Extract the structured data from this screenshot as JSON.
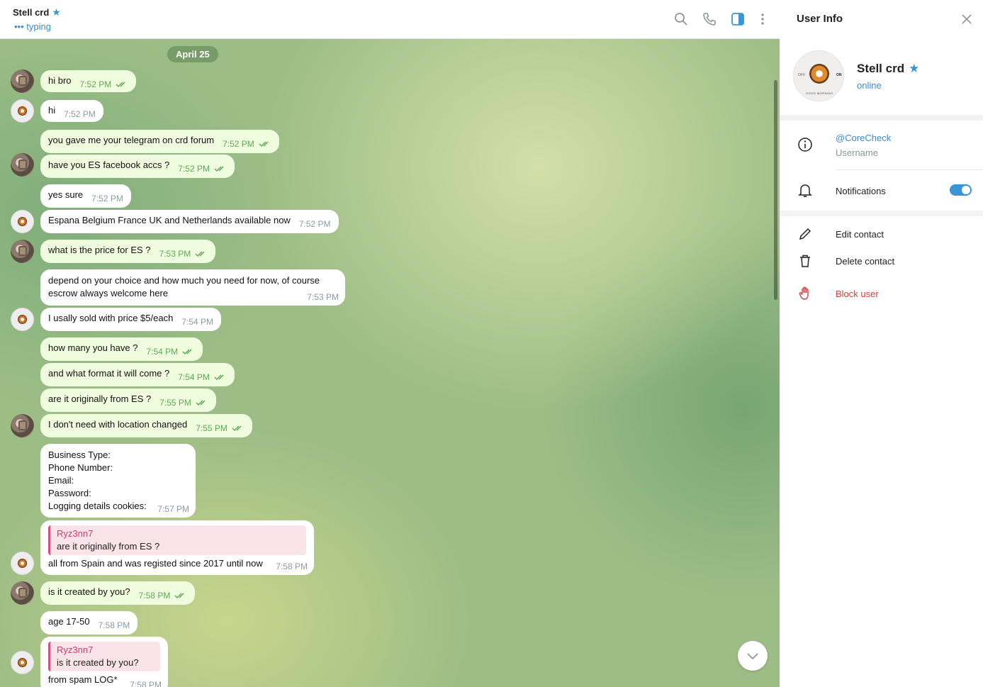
{
  "chat": {
    "name": "Stell crd",
    "status": "typing",
    "date_label": "April 25",
    "messages": [
      {
        "text": "hi bro",
        "time": "7:52 PM",
        "out": true
      },
      {
        "text": "hi",
        "time": "7:52 PM",
        "out": false
      },
      {
        "text": "you gave me your telegram on crd forum",
        "time": "7:52 PM",
        "out": true
      },
      {
        "text": "have you ES facebook accs ?",
        "time": "7:52 PM",
        "out": true
      },
      {
        "text": "yes sure",
        "time": "7:52 PM",
        "out": false
      },
      {
        "text": "Espana Belgium France UK and Netherlands available now",
        "time": "7:52 PM",
        "out": false
      },
      {
        "text": "what is the price for ES ?",
        "time": "7:53 PM",
        "out": true
      },
      {
        "lines": [
          "depend on your choice and how much you need for now, of course",
          "escrow always welcome here"
        ],
        "time": "7:53 PM",
        "out": false
      },
      {
        "text": "I usally sold with price $5/each",
        "time": "7:54 PM",
        "out": false
      },
      {
        "text": "how many you have ?",
        "time": "7:54 PM",
        "out": true
      },
      {
        "text": "and what format it will come ?",
        "time": "7:54 PM",
        "out": true
      },
      {
        "text": "are it originally from ES ?",
        "time": "7:55 PM",
        "out": true
      },
      {
        "text": "I don't need with location changed",
        "time": "7:55 PM",
        "out": true
      },
      {
        "lines": [
          "Business Type:",
          "Phone Number:",
          "Email:",
          "Password:",
          "Logging details cookies:"
        ],
        "time": "7:57 PM",
        "out": false
      },
      {
        "reply_name": "Ryz3nn7",
        "reply_text": "are it originally from ES ?",
        "text": "all from Spain and was registed since 2017 until now",
        "time": "7:58 PM",
        "out": false
      },
      {
        "text": "is it created by you?",
        "time": "7:58 PM",
        "out": true
      },
      {
        "text": "age 17-50",
        "time": "7:58 PM",
        "out": false
      },
      {
        "reply_name": "Ryz3nn7",
        "reply_text": "is it created by you?",
        "text": "from spam LOG*",
        "time": "7:58 PM",
        "out": false
      }
    ]
  },
  "side": {
    "title": "User Info",
    "name": "Stell crd",
    "status": "online",
    "avatar_text": {
      "off": "OFF",
      "on": "ON",
      "caption": "GOOD MORNING"
    },
    "username": "@CoreCheck",
    "username_label": "Username",
    "notifications_label": "Notifications",
    "notifications_on": true,
    "edit_label": "Edit contact",
    "delete_label": "Delete contact",
    "block_label": "Block user"
  },
  "colors": {
    "accent": "#3a95d8",
    "outgoing_bubble": "#effdde",
    "danger": "#d4403a"
  }
}
